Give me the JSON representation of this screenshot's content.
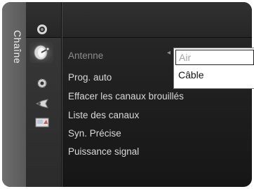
{
  "sidebar": {
    "category_label": "Chaîne"
  },
  "icons": [
    {
      "name": "picture-icon"
    },
    {
      "name": "channel-icon"
    },
    {
      "name": "setup-gear-icon"
    },
    {
      "name": "input-icon"
    },
    {
      "name": "application-icon"
    }
  ],
  "menu": {
    "items": [
      {
        "label": "Antenne",
        "dim": true
      },
      {
        "label": "Prog. auto"
      },
      {
        "label": "Effacer les canaux brouillés"
      },
      {
        "label": "Liste des canaux"
      },
      {
        "label": "Syn. Précise"
      },
      {
        "label": "Puissance signal"
      }
    ]
  },
  "dropdown": {
    "options": [
      {
        "label": "Air",
        "selected": true
      },
      {
        "label": "Câble",
        "selected": false
      }
    ]
  }
}
